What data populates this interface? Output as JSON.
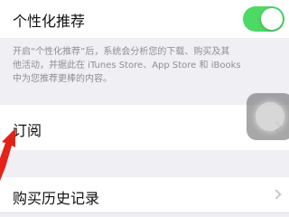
{
  "settings": {
    "recommendations": {
      "label": "个性化推荐",
      "toggle_on": true
    },
    "recommendations_footer": {
      "line1": "开启“个性化推荐”后，系统会分析您的下载、购买及其",
      "line2": "他活动，并据此在 iTunes Store、App Store 和 iBooks",
      "line3": "中为您推荐更棒的内容。"
    },
    "subscriptions": {
      "label": "订阅"
    },
    "purchase_history": {
      "label": "购买历史记录"
    }
  },
  "colors": {
    "toggle_on": "#4cd964",
    "background": "#efeff4",
    "annotation_arrow": "#e32219"
  }
}
